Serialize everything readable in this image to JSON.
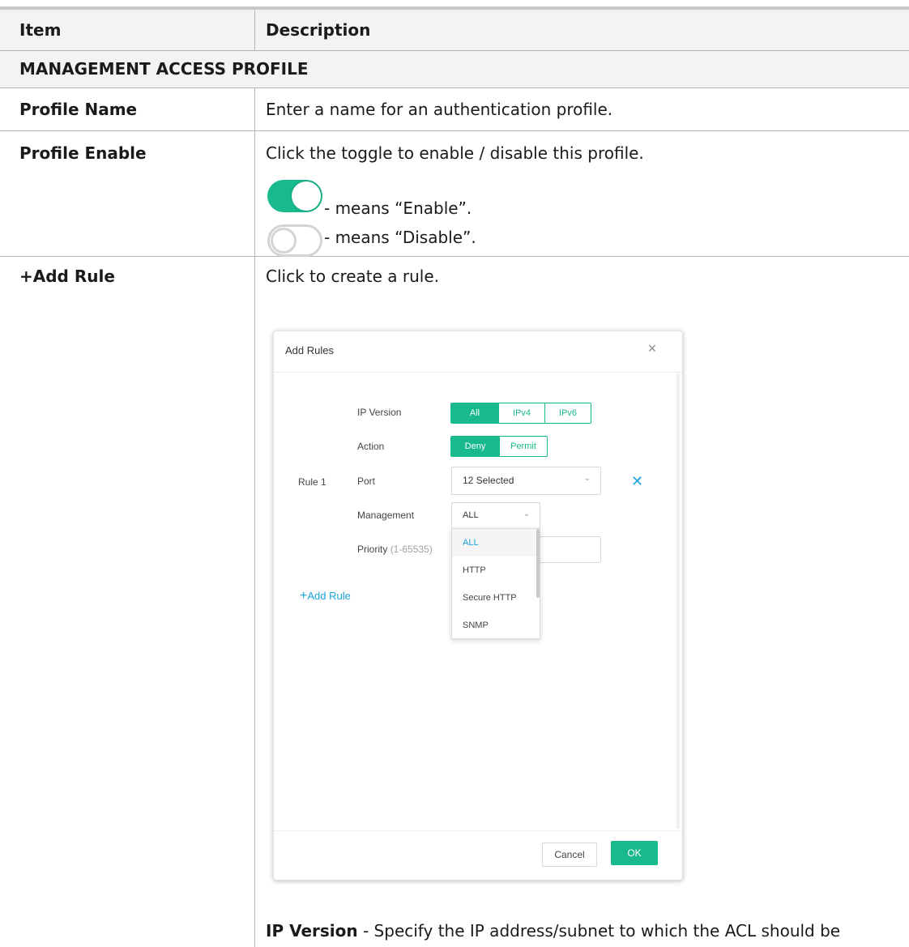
{
  "table": {
    "headers": {
      "item": "Item",
      "description": "Description"
    },
    "section_title": "MANAGEMENT ACCESS PROFILE",
    "rows": [
      {
        "item": "Profile Name",
        "description": "Enter a name for an authentication profile."
      },
      {
        "item": "Profile Enable",
        "description": "Click the toggle to enable / disable this profile.",
        "enable_text": "- means “Enable”.",
        "disable_text": "- means “Disable”."
      },
      {
        "item": "+Add Rule",
        "description": "Click to create a rule."
      }
    ],
    "ip_version_term": "IP Version",
    "ip_version_text": " - Specify the IP address/subnet to which the ACL should be"
  },
  "dialog": {
    "title": "Add Rules",
    "close_icon": "close-icon",
    "rule_label": "Rule 1",
    "ip_version": {
      "label": "IP Version",
      "options": [
        "All",
        "IPv4",
        "IPv6"
      ],
      "selected": "All"
    },
    "action": {
      "label": "Action",
      "options": [
        "Deny",
        "Permit"
      ],
      "selected": "Deny"
    },
    "port": {
      "label": "Port",
      "value": "12 Selected"
    },
    "management": {
      "label": "Management",
      "value": "ALL",
      "options": [
        "ALL",
        "HTTP",
        "Secure HTTP",
        "SNMP"
      ],
      "selected": "ALL"
    },
    "priority": {
      "label": "Priority",
      "range": "(1-65535)",
      "value": ""
    },
    "add_rule_label": "Add Rule",
    "add_rule_icon": "plus-icon",
    "cancel_label": "Cancel",
    "ok_label": "OK"
  },
  "colors": {
    "accent": "#19b98e",
    "link": "#1aa3dc",
    "rule": "#b5b5b5",
    "band": "#f3f3f3"
  }
}
